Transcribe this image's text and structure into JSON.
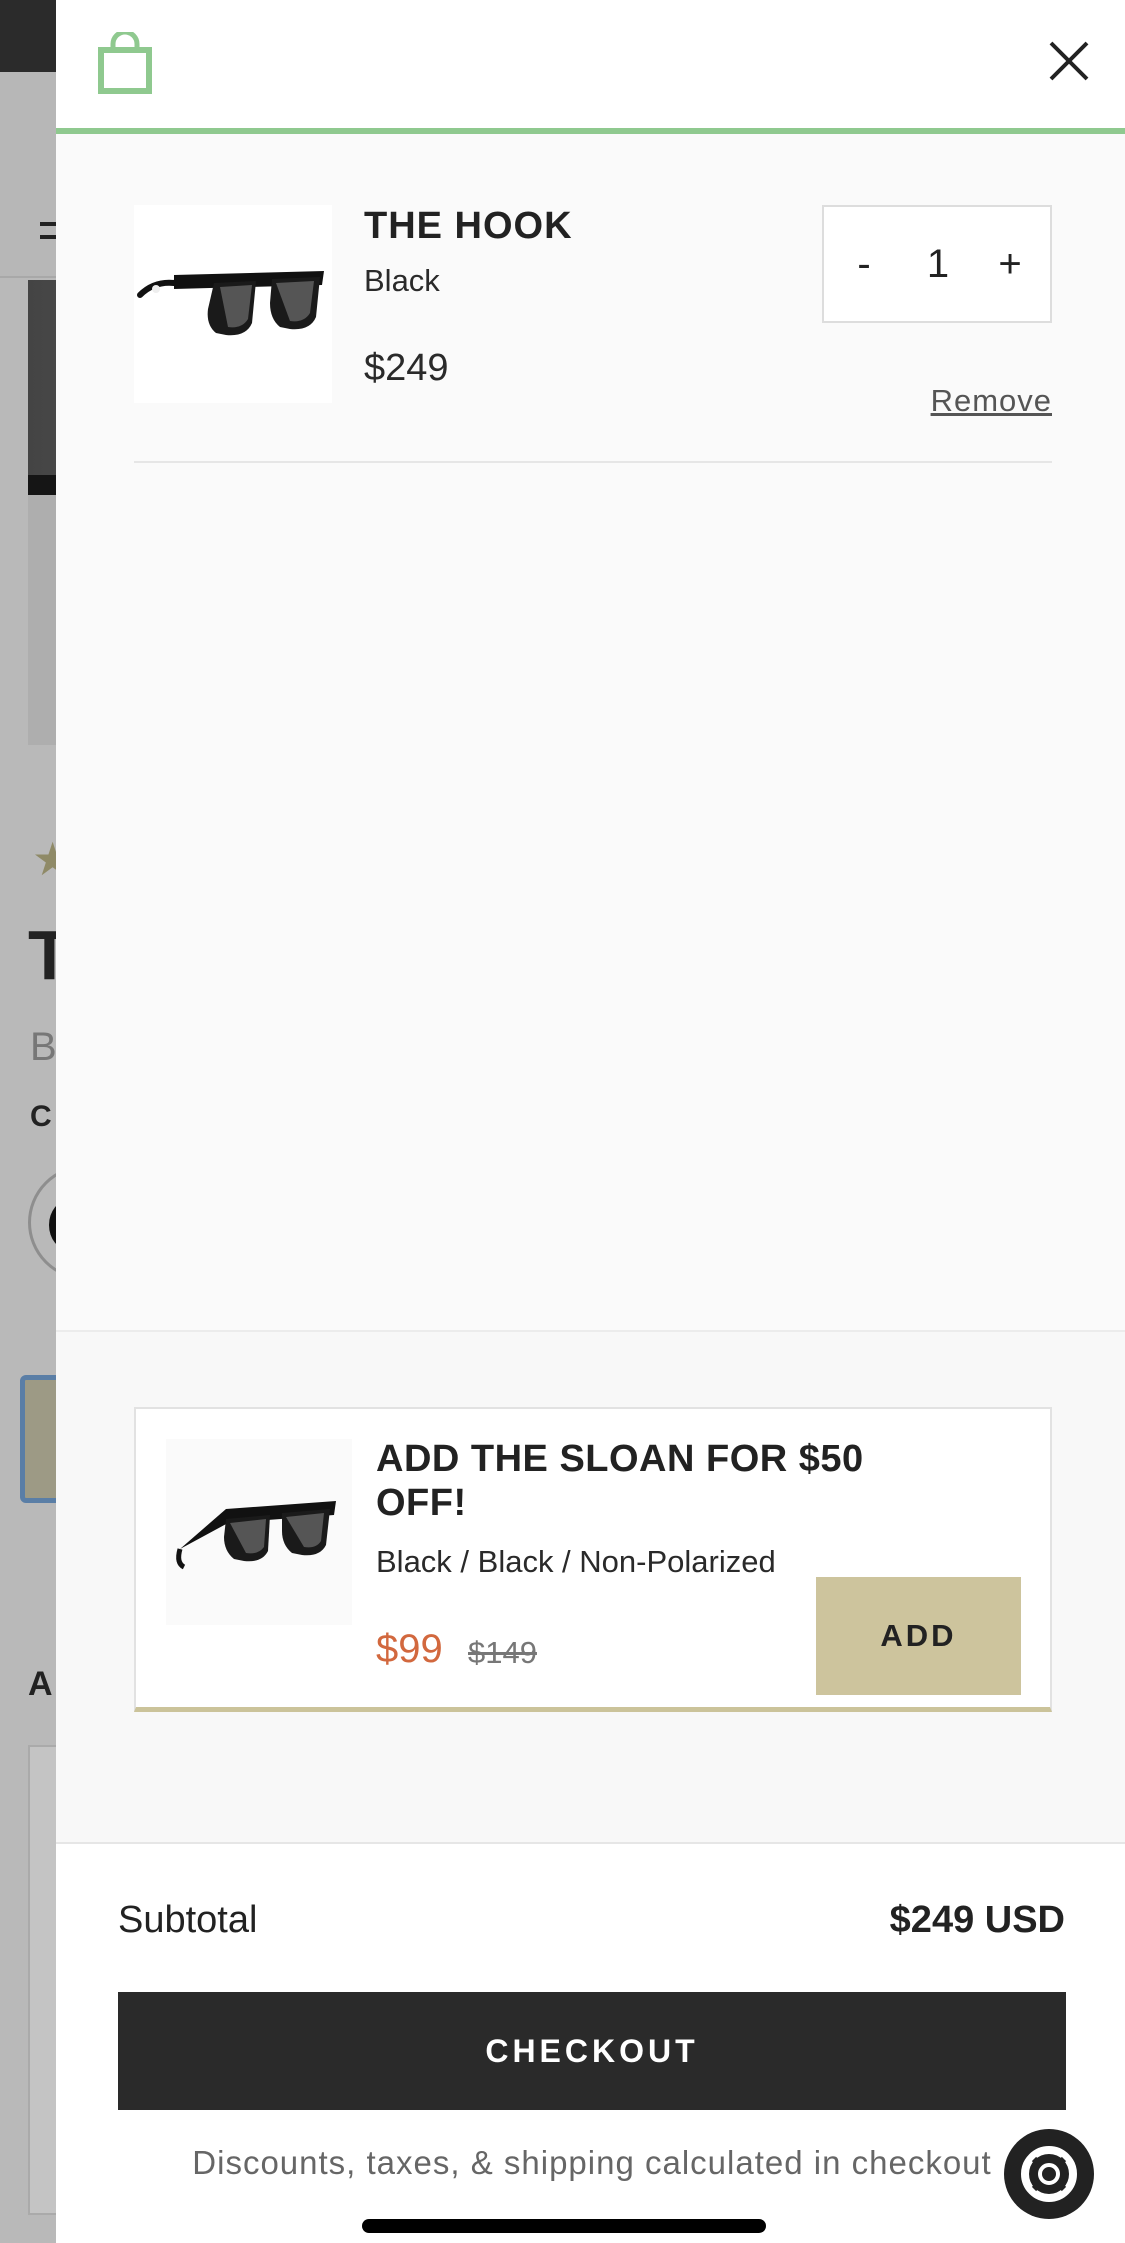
{
  "background_page": {
    "title_initial": "T",
    "subtitle_initial": "B",
    "section_initial": "C",
    "section2_initial": "A"
  },
  "cart": {
    "items": [
      {
        "name": "THE HOOK",
        "variant": "Black",
        "price": "$249",
        "quantity": "1",
        "decrease_label": "-",
        "increase_label": "+",
        "remove_label": "Remove"
      }
    ]
  },
  "upsell": {
    "title": "ADD THE SLOAN FOR $50 OFF!",
    "variant": "Black / Black / Non-Polarized",
    "price": "$99",
    "compare_price": "$149",
    "add_label": "ADD"
  },
  "footer": {
    "subtotal_label": "Subtotal",
    "subtotal_value": "$249 USD",
    "checkout_label": "CHECKOUT",
    "note": "Discounts, taxes, & shipping calculated in checkout"
  },
  "icons": {
    "bag": "shopping-bag-icon",
    "close": "close-icon",
    "help": "help-lifebuoy-icon"
  },
  "colors": {
    "accent_green": "#8fc98f",
    "sale_price": "#d2683e",
    "add_button": "#cdc49d",
    "checkout_button": "#2a2a2a"
  }
}
